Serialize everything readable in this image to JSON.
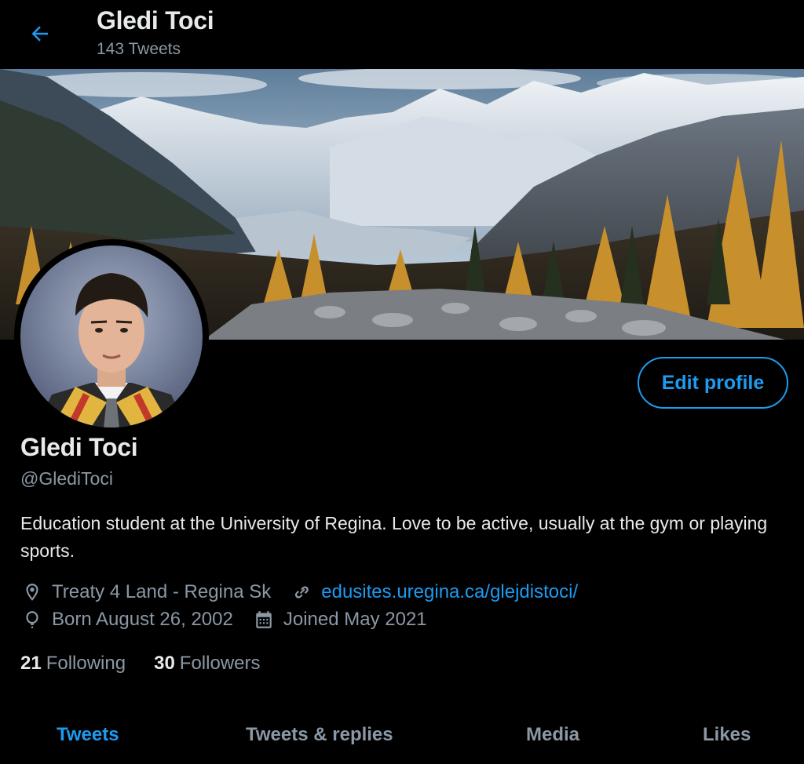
{
  "header": {
    "name": "Gledi Toci",
    "tweet_count": "143 Tweets"
  },
  "profile": {
    "display_name": "Gledi Toci",
    "handle": "@GlediToci",
    "bio": "Education student at the University of Regina. Love to be active, usually at the gym or playing sports.",
    "location": "Treaty 4 Land - Regina Sk",
    "website": "edusites.uregina.ca/glejdistoci/",
    "birthday": "Born August 26, 2002",
    "joined": "Joined May 2021",
    "following_count": "21",
    "following_label": "Following",
    "followers_count": "30",
    "followers_label": "Followers",
    "edit_label": "Edit profile"
  },
  "tabs": [
    {
      "label": "Tweets",
      "active": true
    },
    {
      "label": "Tweets & replies",
      "active": false
    },
    {
      "label": "Media",
      "active": false
    },
    {
      "label": "Likes",
      "active": false
    }
  ],
  "icons": {
    "back": "arrow-left-icon",
    "location": "location-pin-icon",
    "link": "link-icon",
    "birthday": "balloon-icon",
    "joined": "calendar-icon"
  },
  "colors": {
    "accent": "#1d9bf0",
    "background": "#000000",
    "muted": "#8b98a5"
  }
}
